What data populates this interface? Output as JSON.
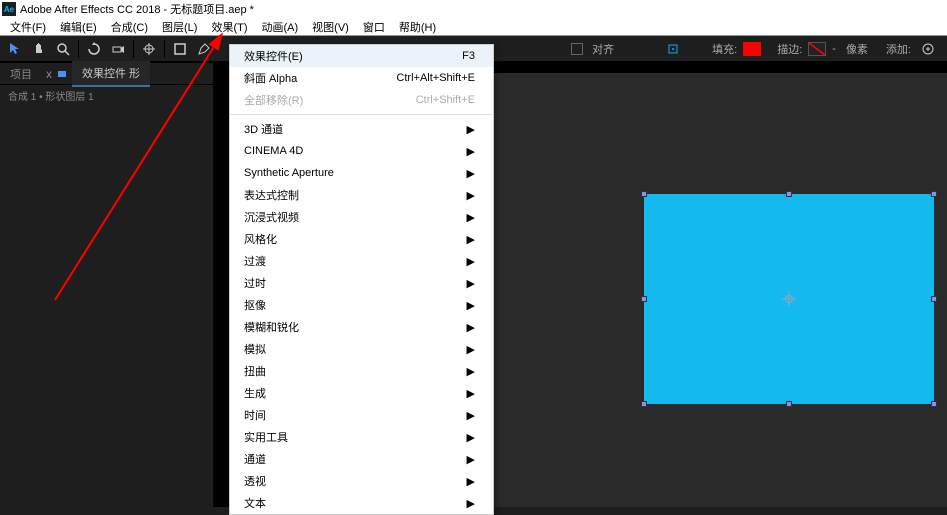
{
  "title_bar": {
    "app_icon": "Ae",
    "title": "Adobe After Effects CC 2018 - 无标题项目.aep *"
  },
  "menubar": {
    "file": "文件(F)",
    "edit": "编辑(E)",
    "composition": "合成(C)",
    "layer": "图层(L)",
    "effect": "效果(T)",
    "animation": "动画(A)",
    "view": "视图(V)",
    "window": "窗口",
    "help": "帮助(H)"
  },
  "toolbar": {
    "align_label": "对齐",
    "fill_label": "填充:",
    "stroke_label": "描边:",
    "dash": "-",
    "px_label": "像素",
    "add_label": "添加:"
  },
  "panel": {
    "project_tab": "项目",
    "tab_x": "x",
    "effect_controls_tab": "效果控件 形",
    "info_line": "合成 1 • 形状图层 1"
  },
  "dropdown": {
    "effect_controls": "效果控件(E)",
    "effect_controls_sc": "F3",
    "ramp_alpha": "斜面 Alpha",
    "ramp_alpha_sc": "Ctrl+Alt+Shift+E",
    "remove_all": "全部移除(R)",
    "remove_all_sc": "Ctrl+Shift+E",
    "ch3d": "3D 通道",
    "c4d": "CINEMA 4D",
    "syn_ap": "Synthetic Aperture",
    "expr_ctrl": "表达式控制",
    "immersive": "沉浸式视频",
    "stylize": "风格化",
    "transition": "过渡",
    "time": "过时",
    "matte": "抠像",
    "blur": "模糊和锐化",
    "simulate": "模拟",
    "distort": "扭曲",
    "generate": "生成",
    "timefx": "时间",
    "utility": "实用工具",
    "channel": "通道",
    "perspective": "透视",
    "text": "文本"
  }
}
